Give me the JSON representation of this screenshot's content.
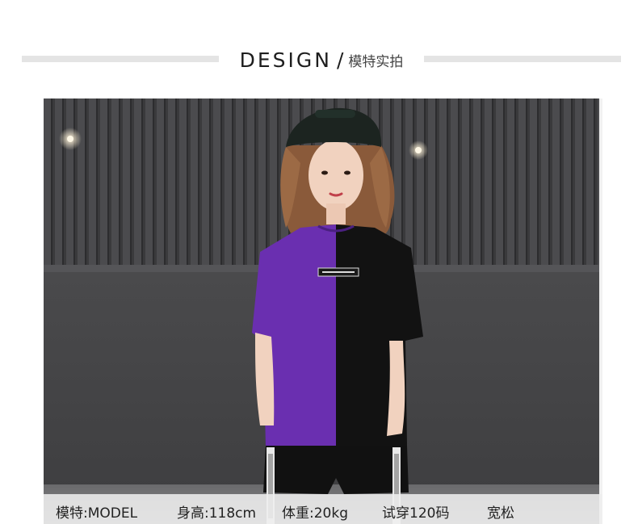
{
  "header": {
    "title": "DESIGN",
    "separator": "/",
    "subtitle": "模特实拍"
  },
  "photo": {
    "description_icon": "model-photo",
    "colors": {
      "wall_top": "#3e3e40",
      "wall_bottom": "#4a4a4c",
      "shirt_purple": "#6a2fb0",
      "shirt_black": "#111111"
    }
  },
  "caption": {
    "model": "模特:MODEL",
    "height": "身高:118cm",
    "weight": "体重:20kg",
    "size": "试穿120码",
    "fit": "宽松"
  }
}
